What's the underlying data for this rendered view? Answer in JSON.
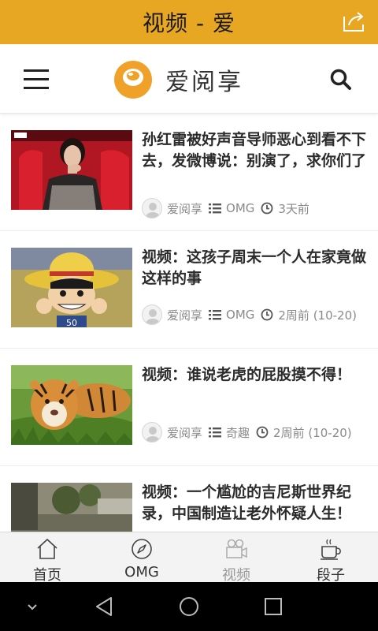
{
  "titlebar": {
    "title": "视频 - 爱"
  },
  "header": {
    "logo_text": "爱阅享"
  },
  "items": [
    {
      "title": "孙红雷被好声音导师恶心到看不下去，发微博说：别演了，求你们了",
      "author": "爱阅享",
      "category": "OMG",
      "time": "3天前",
      "thumb": "thumb-voice-show"
    },
    {
      "title": "视频：这孩子周末一个人在家竟做这样的事",
      "author": "爱阅享",
      "category": "OMG",
      "time": "2周前 (10-20)",
      "thumb": "thumb-cartoon-boy"
    },
    {
      "title": "视频：谁说老虎的屁股摸不得！",
      "author": "爱阅享",
      "category": "奇趣",
      "time": "2周前 (10-20)",
      "thumb": "thumb-tiger"
    },
    {
      "title": "视频：一个尴尬的吉尼斯世界纪录，中国制造让老外怀疑人生！",
      "thumb": "thumb-outdoor-scene"
    }
  ],
  "tabs": [
    {
      "label": "首页",
      "icon": "home-icon"
    },
    {
      "label": "OMG",
      "icon": "compass-icon"
    },
    {
      "label": "视频",
      "icon": "video-camera-icon",
      "active": true
    },
    {
      "label": "段子",
      "icon": "coffee-cup-icon"
    }
  ],
  "colors": {
    "accent": "#e8a723",
    "logo": "#f0a12a"
  }
}
